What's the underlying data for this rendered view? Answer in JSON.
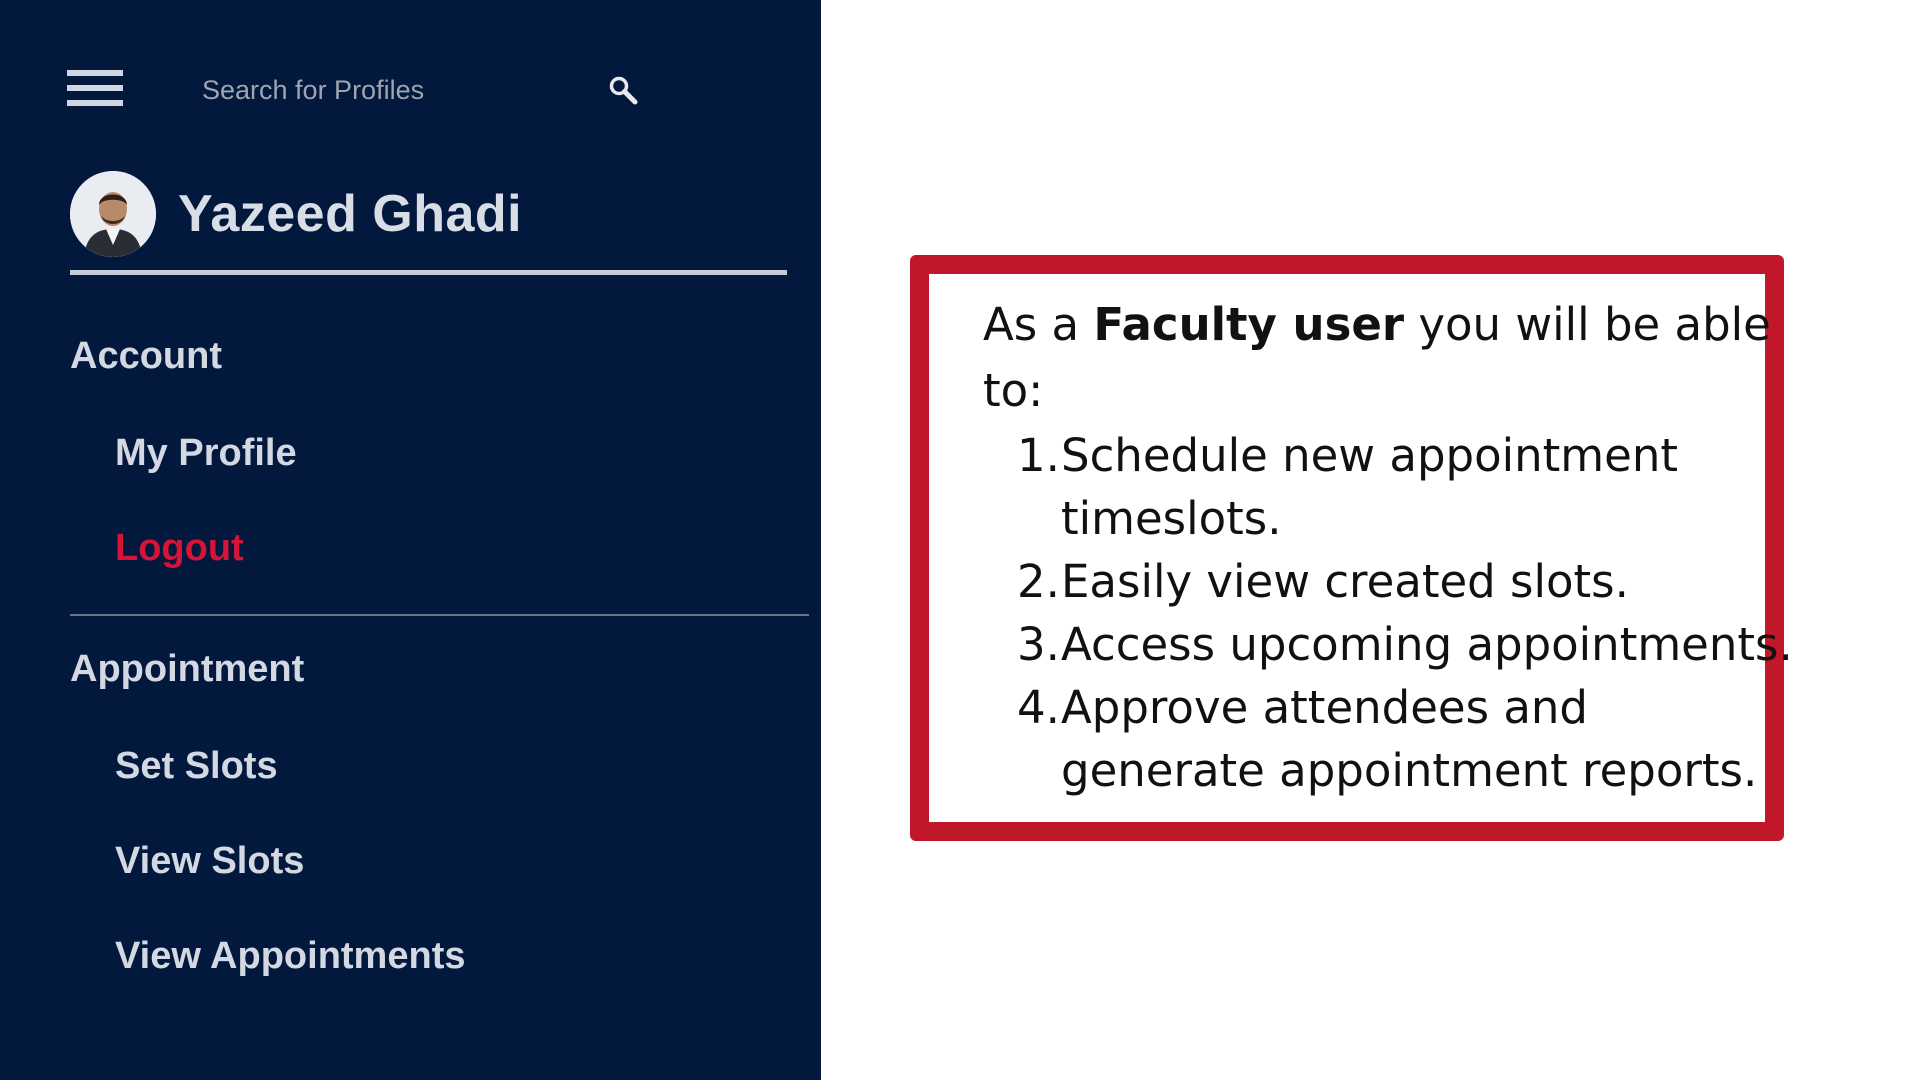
{
  "sidebar": {
    "search": {
      "placeholder": "Search for Profiles"
    },
    "profile": {
      "name": "Yazeed Ghadi"
    },
    "account": {
      "title": "Account",
      "items": [
        {
          "label": "My Profile"
        },
        {
          "label": "Logout"
        }
      ]
    },
    "appointment": {
      "title": "Appointment",
      "items": [
        {
          "label": "Set Slots"
        },
        {
          "label": "View Slots"
        },
        {
          "label": "View Appointments"
        }
      ]
    }
  },
  "info": {
    "intro_prefix": "As a ",
    "intro_bold": "Faculty user",
    "intro_suffix": " you will be able to:",
    "items": [
      {
        "num": "1.",
        "text": "Schedule new appointment timeslots."
      },
      {
        "num": "2.",
        "text": "Easily view created slots."
      },
      {
        "num": "3.",
        "text": "Access upcoming appointments."
      },
      {
        "num": "4.",
        "text": "Approve attendees and generate appointment reports."
      }
    ]
  },
  "colors": {
    "sidebar_bg": "#02183c",
    "logout": "#d6143a",
    "box_border": "#c0182a"
  }
}
